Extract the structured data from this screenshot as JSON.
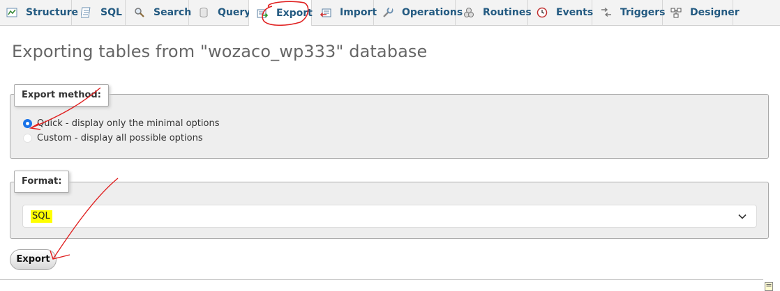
{
  "tabs": [
    {
      "label": "Structure",
      "icon": "structure-icon"
    },
    {
      "label": "SQL",
      "icon": "sql-icon"
    },
    {
      "label": "Search",
      "icon": "search-icon"
    },
    {
      "label": "Query",
      "icon": "query-icon"
    },
    {
      "label": "Export",
      "icon": "export-icon",
      "active": true
    },
    {
      "label": "Import",
      "icon": "import-icon"
    },
    {
      "label": "Operations",
      "icon": "operations-icon"
    },
    {
      "label": "Routines",
      "icon": "routines-icon"
    },
    {
      "label": "Events",
      "icon": "events-icon"
    },
    {
      "label": "Triggers",
      "icon": "triggers-icon"
    },
    {
      "label": "Designer",
      "icon": "designer-icon"
    }
  ],
  "page_title": "Exporting tables from \"wozaco_wp333\" database",
  "export_method": {
    "legend": "Export method:",
    "options": [
      {
        "label": "Quick - display only the minimal options",
        "selected": true
      },
      {
        "label": "Custom - display all possible options",
        "selected": false
      }
    ]
  },
  "format": {
    "legend": "Format:",
    "selected": "SQL"
  },
  "export_button": "Export",
  "colors": {
    "tab_text": "#235a81",
    "annotation_red": "#e02020",
    "highlight": "#ffff00",
    "radio_checked": "#1a73e8"
  }
}
